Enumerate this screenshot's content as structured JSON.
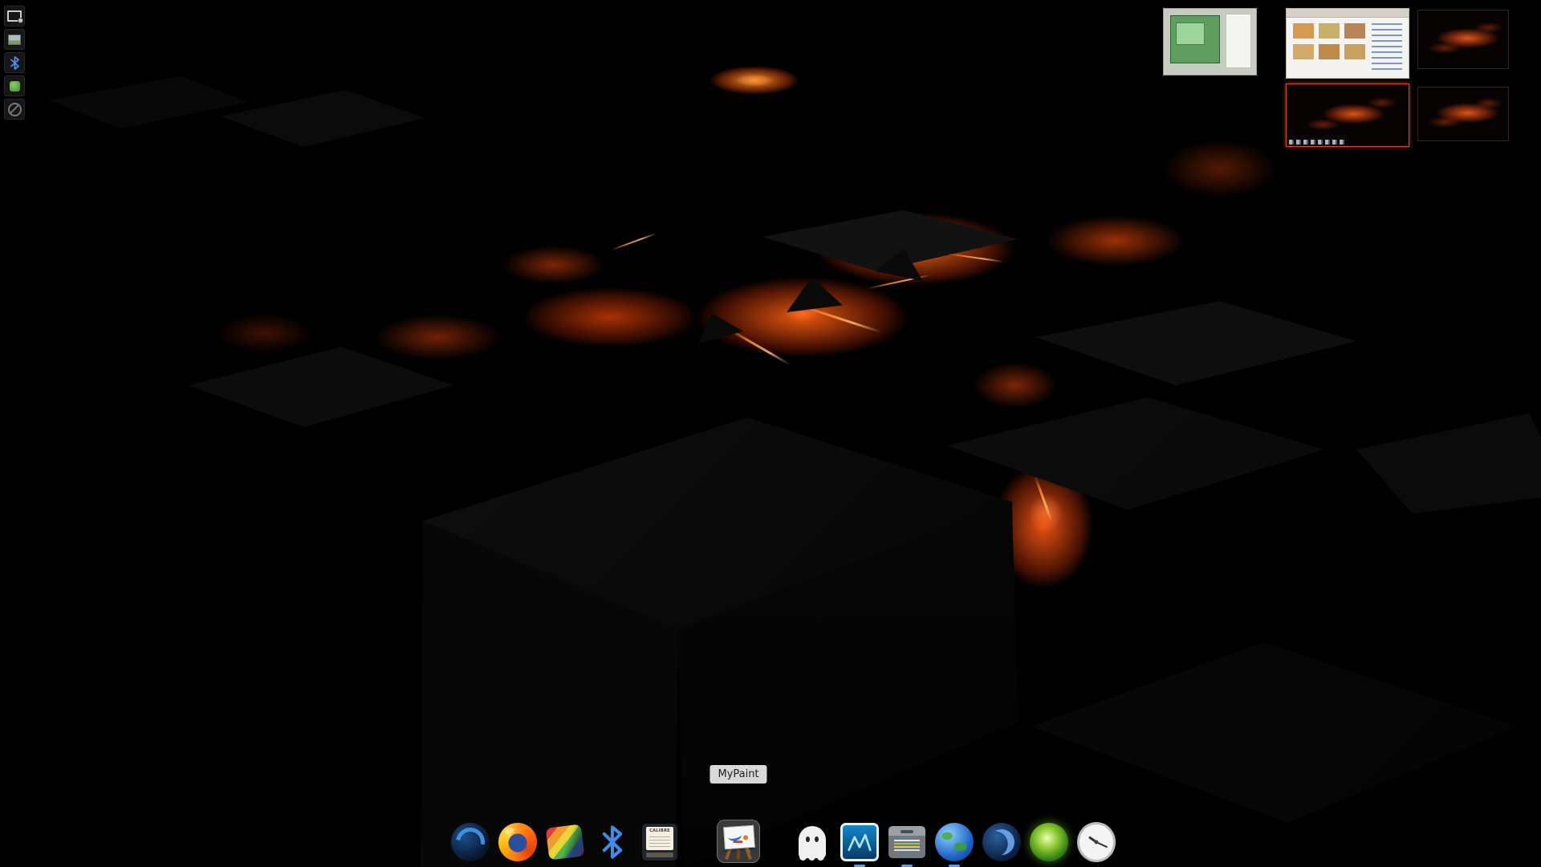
{
  "tooltip": {
    "text": "MyPaint"
  },
  "panel": {
    "items": [
      {
        "name": "screenshot-tool-icon"
      },
      {
        "name": "image-viewer-icon"
      },
      {
        "name": "bluetooth-icon"
      },
      {
        "name": "software-update-icon"
      },
      {
        "name": "network-disabled-icon"
      }
    ]
  },
  "pager": {
    "workspaces": [
      {
        "name": "workspace-green-window",
        "active": false
      },
      {
        "name": "workspace-browser-page",
        "active": false
      },
      {
        "name": "workspace-desktop-top-right",
        "active": false
      },
      {
        "name": "workspace-active-desktop",
        "active": true
      },
      {
        "name": "workspace-desktop-bottom-right",
        "active": false
      }
    ]
  },
  "dock": {
    "items": [
      {
        "name": "blue-swirl-browser",
        "running": false
      },
      {
        "name": "firefox",
        "running": false
      },
      {
        "name": "photos-rainbow",
        "running": false
      },
      {
        "name": "bluetooth",
        "running": false
      },
      {
        "name": "calibre",
        "label": "CALIBRE",
        "running": false
      },
      {
        "name": "mypaint",
        "tooltip": "MyPaint",
        "highlighted": true,
        "running": false
      },
      {
        "name": "ghost-app",
        "running": false
      },
      {
        "name": "system-monitor",
        "running": true
      },
      {
        "name": "archive-manager",
        "running": true
      },
      {
        "name": "web-browser-globe",
        "running": true
      },
      {
        "name": "blue-orb-app",
        "running": false
      },
      {
        "name": "green-orb-app",
        "running": false
      },
      {
        "name": "clock",
        "running": false
      }
    ]
  },
  "colors": {
    "lava_bright": "#ff6a1a",
    "lava_deep": "#8a2506",
    "active_workspace_border": "#d8472b",
    "tooltip_bg": "#d9d9d9",
    "tooltip_text": "#1c1c1c",
    "dock_highlight": "rgba(255,255,255,0.22)",
    "running_indicator": "#4aa3ff",
    "bluetooth_blue": "#3f8ce8"
  }
}
